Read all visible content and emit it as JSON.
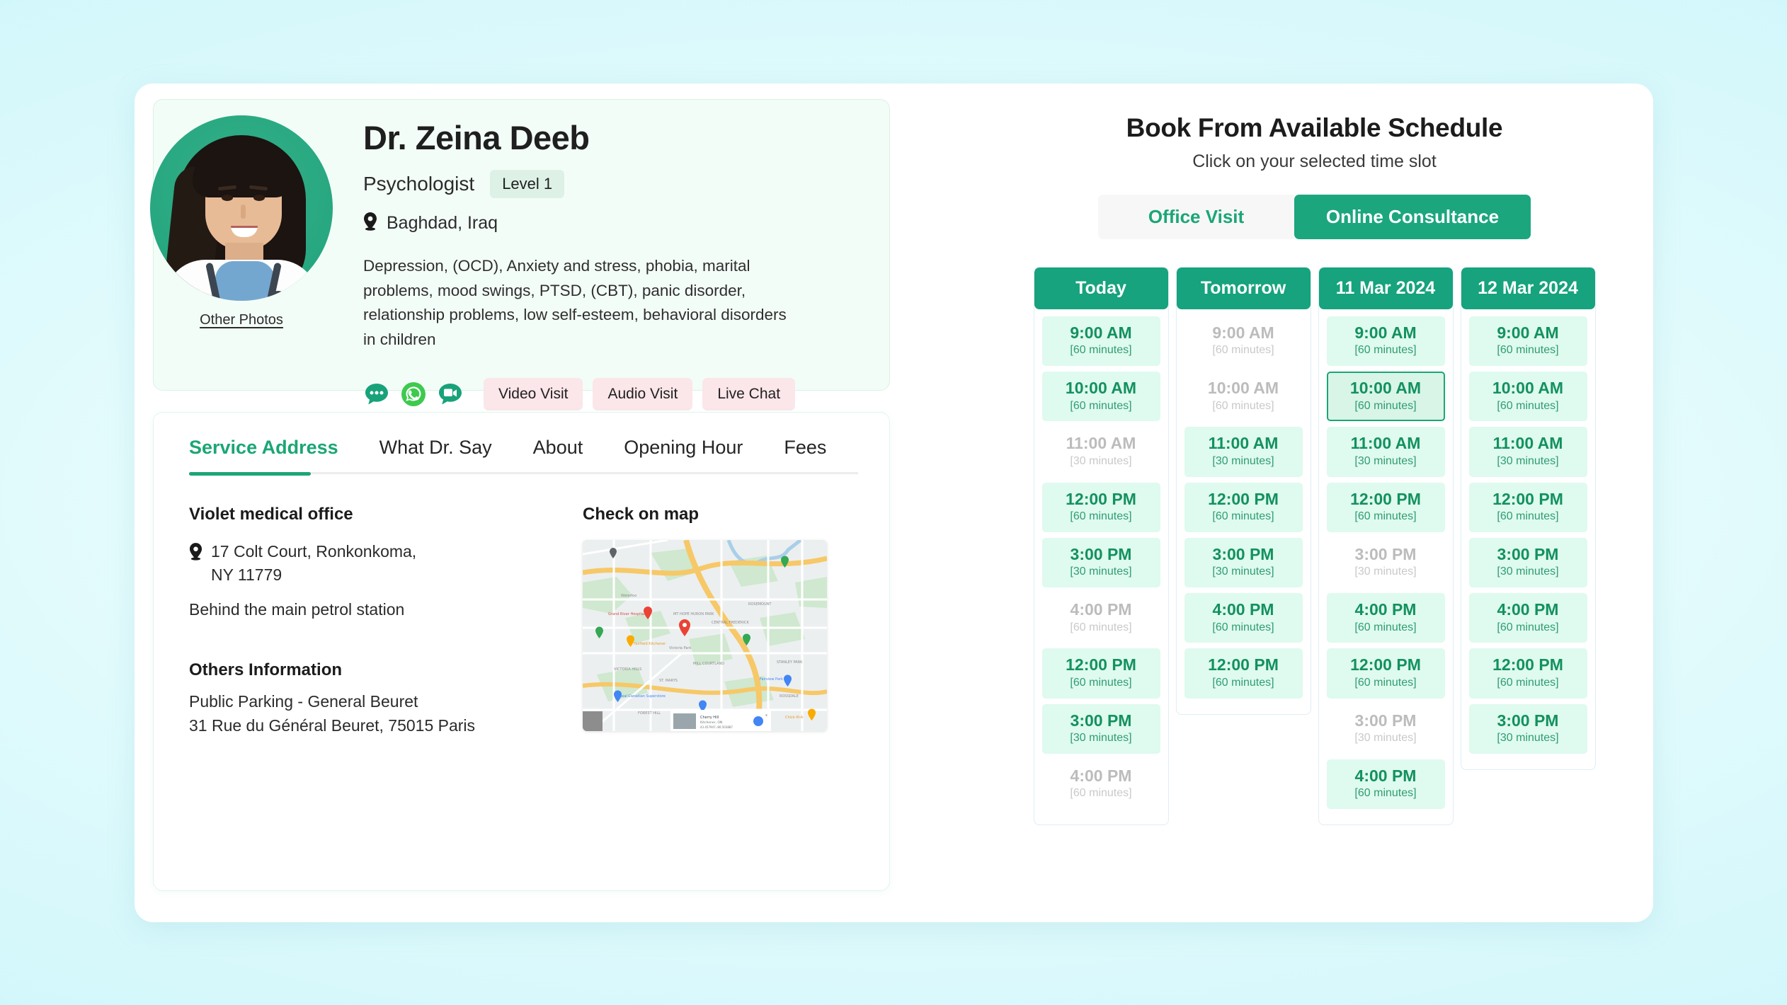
{
  "theme": {
    "brand_green": "#1ba67e",
    "header_green": "#16a37d",
    "slot_bg": "#dffaef",
    "page_bg": "#d2f7fb",
    "pill_pink": "#fbe6ea"
  },
  "profile": {
    "name": "Dr. Zeina Deeb",
    "role": "Psychologist",
    "level_badge": "Level 1",
    "location": "Baghdad, Iraq",
    "bio": "Depression, (OCD), Anxiety and stress, phobia, marital problems, mood swings, PTSD, (CBT), panic disorder, relationship problems, low self-esteem, behavioral disorders in children",
    "other_photos_link": "Other Photos",
    "social_icons": [
      "chat-bubble-icon",
      "whatsapp-icon",
      "video-message-icon"
    ],
    "action_buttons": [
      "Video Visit",
      "Audio Visit",
      "Live Chat"
    ]
  },
  "details": {
    "tabs": [
      {
        "label": "Service Address",
        "active": true
      },
      {
        "label": "What Dr. Say",
        "active": false
      },
      {
        "label": "About",
        "active": false
      },
      {
        "label": "Opening Hour",
        "active": false
      },
      {
        "label": "Fees",
        "active": false
      }
    ],
    "office_title": "Violet medical office",
    "address_line1": "17 Colt Court, Ronkonkoma,",
    "address_line2": "NY 11779",
    "address_note": "Behind the main petrol station",
    "others_title": "Others Information",
    "others_line1": "Public Parking - General Beuret",
    "others_line2": "31 Rue du Général Beuret, 75015 Paris",
    "map_title": "Check on map"
  },
  "schedule": {
    "title": "Book From Available Schedule",
    "subtitle": "Click on your selected time slot",
    "office_visit_label": "Office Visit",
    "online_consultance_label": "Online Consultance",
    "active_mode": "Online Consultance",
    "days": [
      {
        "header": "Today",
        "slots": [
          {
            "time": "9:00 AM",
            "duration": "[60 minutes]",
            "state": "available"
          },
          {
            "time": "10:00 AM",
            "duration": "[60 minutes]",
            "state": "available"
          },
          {
            "time": "11:00 AM",
            "duration": "[30 minutes]",
            "state": "unavailable"
          },
          {
            "time": "12:00 PM",
            "duration": "[60 minutes]",
            "state": "available"
          },
          {
            "time": "3:00 PM",
            "duration": "[30 minutes]",
            "state": "available"
          },
          {
            "time": "4:00 PM",
            "duration": "[60 minutes]",
            "state": "unavailable"
          },
          {
            "time": "12:00 PM",
            "duration": "[60 minutes]",
            "state": "available"
          },
          {
            "time": "3:00 PM",
            "duration": "[30 minutes]",
            "state": "available"
          },
          {
            "time": "4:00 PM",
            "duration": "[60 minutes]",
            "state": "unavailable"
          }
        ]
      },
      {
        "header": "Tomorrow",
        "slots": [
          {
            "time": "9:00 AM",
            "duration": "[60 minutes]",
            "state": "unavailable"
          },
          {
            "time": "10:00 AM",
            "duration": "[60 minutes]",
            "state": "unavailable"
          },
          {
            "time": "11:00 AM",
            "duration": "[30 minutes]",
            "state": "available"
          },
          {
            "time": "12:00 PM",
            "duration": "[60 minutes]",
            "state": "available"
          },
          {
            "time": "3:00 PM",
            "duration": "[30 minutes]",
            "state": "available"
          },
          {
            "time": "4:00 PM",
            "duration": "[60 minutes]",
            "state": "available"
          },
          {
            "time": "12:00 PM",
            "duration": "[60 minutes]",
            "state": "available"
          }
        ]
      },
      {
        "header": "11 Mar 2024",
        "slots": [
          {
            "time": "9:00 AM",
            "duration": "[60 minutes]",
            "state": "available"
          },
          {
            "time": "10:00 AM",
            "duration": "[60 minutes]",
            "state": "selected"
          },
          {
            "time": "11:00 AM",
            "duration": "[30 minutes]",
            "state": "available"
          },
          {
            "time": "12:00 PM",
            "duration": "[60 minutes]",
            "state": "available"
          },
          {
            "time": "3:00 PM",
            "duration": "[30 minutes]",
            "state": "unavailable"
          },
          {
            "time": "4:00 PM",
            "duration": "[60 minutes]",
            "state": "available"
          },
          {
            "time": "12:00 PM",
            "duration": "[60 minutes]",
            "state": "available"
          },
          {
            "time": "3:00 PM",
            "duration": "[30 minutes]",
            "state": "unavailable"
          },
          {
            "time": "4:00 PM",
            "duration": "[60 minutes]",
            "state": "available"
          }
        ]
      },
      {
        "header": "12 Mar 2024",
        "slots": [
          {
            "time": "9:00 AM",
            "duration": "[60 minutes]",
            "state": "available"
          },
          {
            "time": "10:00 AM",
            "duration": "[60 minutes]",
            "state": "available"
          },
          {
            "time": "11:00 AM",
            "duration": "[30 minutes]",
            "state": "available"
          },
          {
            "time": "12:00 PM",
            "duration": "[60 minutes]",
            "state": "available"
          },
          {
            "time": "3:00 PM",
            "duration": "[30 minutes]",
            "state": "available"
          },
          {
            "time": "4:00 PM",
            "duration": "[60 minutes]",
            "state": "available"
          },
          {
            "time": "12:00 PM",
            "duration": "[60 minutes]",
            "state": "available"
          },
          {
            "time": "3:00 PM",
            "duration": "[30 minutes]",
            "state": "available"
          }
        ]
      }
    ]
  }
}
